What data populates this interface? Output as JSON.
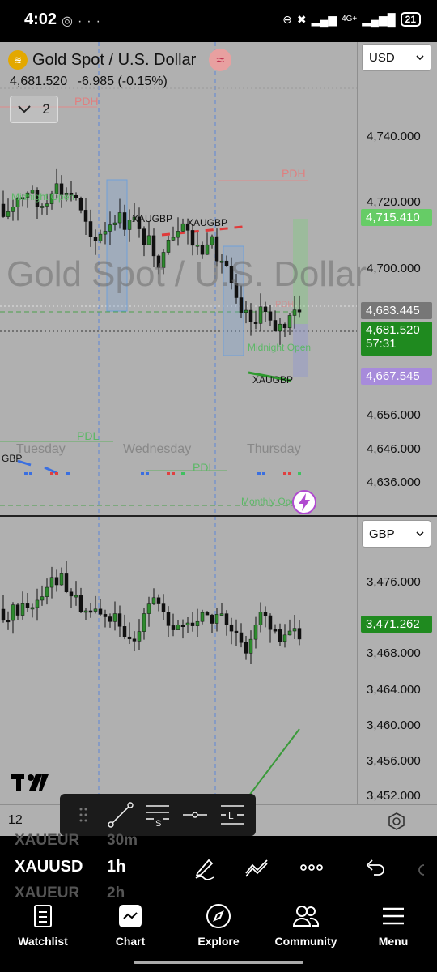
{
  "status_bar": {
    "time": "4:02",
    "left_icons": [
      "whatsapp-icon",
      "more-dots-icon"
    ],
    "network": "4G+",
    "battery": "21"
  },
  "chart": {
    "symbol_title": "Gold Spot / U.S. Dollar",
    "last_price": "4,681.520",
    "change": "-6.985 (-0.15%)",
    "indicator_count": "2",
    "watermark": "Gold Spot / U.S. Dollar",
    "top_currency": "USD",
    "bottom_currency": "GBP",
    "top_price_labels": [
      "4,740.000",
      "4,720.000",
      "4,700.000",
      "4,656.000",
      "4,646.000",
      "4,636.000"
    ],
    "top_price_tags": {
      "green": "4,715.410",
      "grey": "4,683.445",
      "current": "4,681.520",
      "countdown": "57:31",
      "purple": "4,667.545"
    },
    "bottom_price_labels": [
      "3,476.000",
      "3,468.000",
      "3,464.000",
      "3,460.000",
      "3,456.000",
      "3,452.000"
    ],
    "bottom_price_tag": "3,471.262",
    "day_labels": [
      "Tuesday",
      "Wednesday",
      "Thursday"
    ],
    "annotations": {
      "pdh_1": "PDH",
      "pdh_2": "PDH",
      "pdh_3": "PDH",
      "pdl": "PDL",
      "midnight_open_1": "Midnight Open",
      "midnight_open_2": "Midnight Open",
      "xaugbp_1": "XAUGBP",
      "xaugbp_2": "XAUGBP",
      "xaugbp_3": "XAUGBP",
      "gbp": "GBP",
      "monthly_open": "Monthly Open",
      "pdl_2": "PDL"
    },
    "time_axis_label": "12",
    "colors": {
      "background": "#b0b0b0",
      "bull": "#2e8b2e",
      "bear": "#111111",
      "green_tag": "#66cc66",
      "current_tag": "#1f8a1f",
      "purple_tag": "#a78bdb",
      "grey_tag": "#777777"
    }
  },
  "drawing_toolbar": {
    "tools": [
      "drag-handle-icon",
      "trend-line-icon",
      "fib-retracement-icon",
      "horizontal-line-icon",
      "long-position-icon"
    ]
  },
  "symbol_bar": {
    "ghost_above_symbol": "XAUEUR",
    "ghost_above_interval": "30m",
    "symbol": "XAUUSD",
    "interval": "1h",
    "ghost_below_symbol": "XAUEUR",
    "ghost_below_interval": "2h"
  },
  "bottom_nav": {
    "items": [
      {
        "label": "Watchlist",
        "icon": "watchlist-icon"
      },
      {
        "label": "Chart",
        "icon": "chart-icon"
      },
      {
        "label": "Explore",
        "icon": "compass-icon"
      },
      {
        "label": "Community",
        "icon": "community-icon"
      },
      {
        "label": "Menu",
        "icon": "menu-icon"
      }
    ]
  }
}
